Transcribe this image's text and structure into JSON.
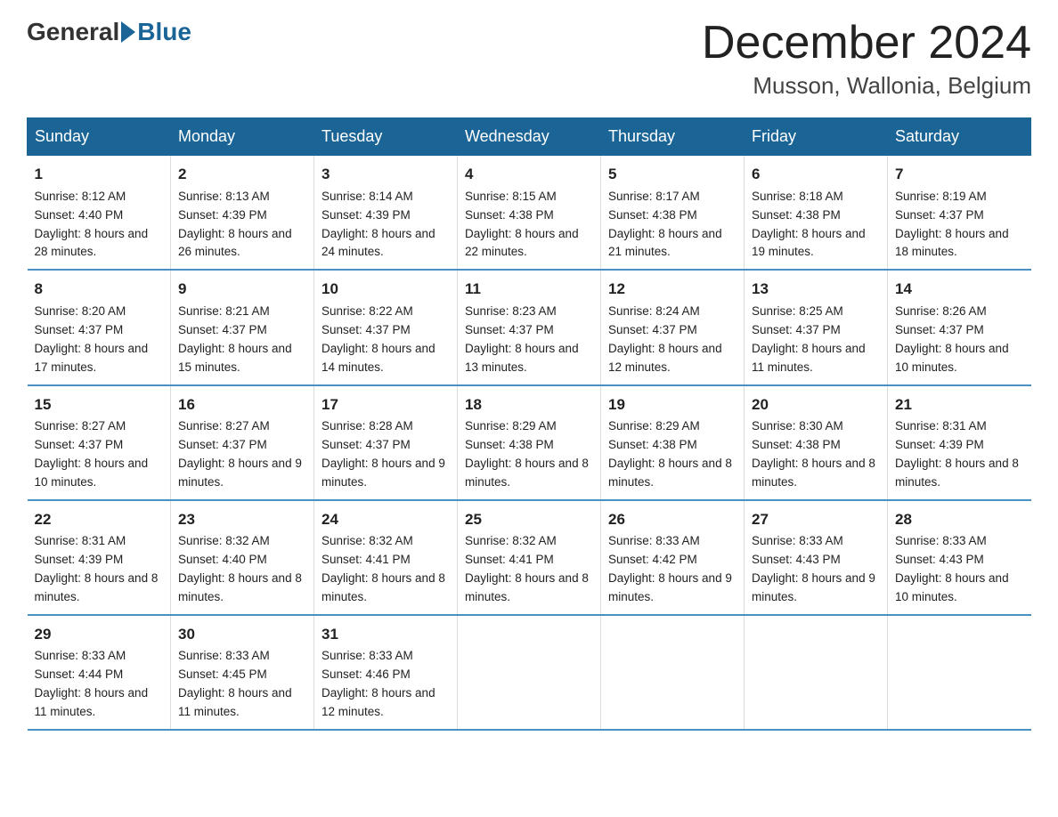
{
  "header": {
    "logo_general": "General",
    "logo_blue": "Blue",
    "month_title": "December 2024",
    "location": "Musson, Wallonia, Belgium"
  },
  "days_of_week": [
    "Sunday",
    "Monday",
    "Tuesday",
    "Wednesday",
    "Thursday",
    "Friday",
    "Saturday"
  ],
  "weeks": [
    [
      {
        "day": "1",
        "sunrise": "Sunrise: 8:12 AM",
        "sunset": "Sunset: 4:40 PM",
        "daylight": "Daylight: 8 hours and 28 minutes."
      },
      {
        "day": "2",
        "sunrise": "Sunrise: 8:13 AM",
        "sunset": "Sunset: 4:39 PM",
        "daylight": "Daylight: 8 hours and 26 minutes."
      },
      {
        "day": "3",
        "sunrise": "Sunrise: 8:14 AM",
        "sunset": "Sunset: 4:39 PM",
        "daylight": "Daylight: 8 hours and 24 minutes."
      },
      {
        "day": "4",
        "sunrise": "Sunrise: 8:15 AM",
        "sunset": "Sunset: 4:38 PM",
        "daylight": "Daylight: 8 hours and 22 minutes."
      },
      {
        "day": "5",
        "sunrise": "Sunrise: 8:17 AM",
        "sunset": "Sunset: 4:38 PM",
        "daylight": "Daylight: 8 hours and 21 minutes."
      },
      {
        "day": "6",
        "sunrise": "Sunrise: 8:18 AM",
        "sunset": "Sunset: 4:38 PM",
        "daylight": "Daylight: 8 hours and 19 minutes."
      },
      {
        "day": "7",
        "sunrise": "Sunrise: 8:19 AM",
        "sunset": "Sunset: 4:37 PM",
        "daylight": "Daylight: 8 hours and 18 minutes."
      }
    ],
    [
      {
        "day": "8",
        "sunrise": "Sunrise: 8:20 AM",
        "sunset": "Sunset: 4:37 PM",
        "daylight": "Daylight: 8 hours and 17 minutes."
      },
      {
        "day": "9",
        "sunrise": "Sunrise: 8:21 AM",
        "sunset": "Sunset: 4:37 PM",
        "daylight": "Daylight: 8 hours and 15 minutes."
      },
      {
        "day": "10",
        "sunrise": "Sunrise: 8:22 AM",
        "sunset": "Sunset: 4:37 PM",
        "daylight": "Daylight: 8 hours and 14 minutes."
      },
      {
        "day": "11",
        "sunrise": "Sunrise: 8:23 AM",
        "sunset": "Sunset: 4:37 PM",
        "daylight": "Daylight: 8 hours and 13 minutes."
      },
      {
        "day": "12",
        "sunrise": "Sunrise: 8:24 AM",
        "sunset": "Sunset: 4:37 PM",
        "daylight": "Daylight: 8 hours and 12 minutes."
      },
      {
        "day": "13",
        "sunrise": "Sunrise: 8:25 AM",
        "sunset": "Sunset: 4:37 PM",
        "daylight": "Daylight: 8 hours and 11 minutes."
      },
      {
        "day": "14",
        "sunrise": "Sunrise: 8:26 AM",
        "sunset": "Sunset: 4:37 PM",
        "daylight": "Daylight: 8 hours and 10 minutes."
      }
    ],
    [
      {
        "day": "15",
        "sunrise": "Sunrise: 8:27 AM",
        "sunset": "Sunset: 4:37 PM",
        "daylight": "Daylight: 8 hours and 10 minutes."
      },
      {
        "day": "16",
        "sunrise": "Sunrise: 8:27 AM",
        "sunset": "Sunset: 4:37 PM",
        "daylight": "Daylight: 8 hours and 9 minutes."
      },
      {
        "day": "17",
        "sunrise": "Sunrise: 8:28 AM",
        "sunset": "Sunset: 4:37 PM",
        "daylight": "Daylight: 8 hours and 9 minutes."
      },
      {
        "day": "18",
        "sunrise": "Sunrise: 8:29 AM",
        "sunset": "Sunset: 4:38 PM",
        "daylight": "Daylight: 8 hours and 8 minutes."
      },
      {
        "day": "19",
        "sunrise": "Sunrise: 8:29 AM",
        "sunset": "Sunset: 4:38 PM",
        "daylight": "Daylight: 8 hours and 8 minutes."
      },
      {
        "day": "20",
        "sunrise": "Sunrise: 8:30 AM",
        "sunset": "Sunset: 4:38 PM",
        "daylight": "Daylight: 8 hours and 8 minutes."
      },
      {
        "day": "21",
        "sunrise": "Sunrise: 8:31 AM",
        "sunset": "Sunset: 4:39 PM",
        "daylight": "Daylight: 8 hours and 8 minutes."
      }
    ],
    [
      {
        "day": "22",
        "sunrise": "Sunrise: 8:31 AM",
        "sunset": "Sunset: 4:39 PM",
        "daylight": "Daylight: 8 hours and 8 minutes."
      },
      {
        "day": "23",
        "sunrise": "Sunrise: 8:32 AM",
        "sunset": "Sunset: 4:40 PM",
        "daylight": "Daylight: 8 hours and 8 minutes."
      },
      {
        "day": "24",
        "sunrise": "Sunrise: 8:32 AM",
        "sunset": "Sunset: 4:41 PM",
        "daylight": "Daylight: 8 hours and 8 minutes."
      },
      {
        "day": "25",
        "sunrise": "Sunrise: 8:32 AM",
        "sunset": "Sunset: 4:41 PM",
        "daylight": "Daylight: 8 hours and 8 minutes."
      },
      {
        "day": "26",
        "sunrise": "Sunrise: 8:33 AM",
        "sunset": "Sunset: 4:42 PM",
        "daylight": "Daylight: 8 hours and 9 minutes."
      },
      {
        "day": "27",
        "sunrise": "Sunrise: 8:33 AM",
        "sunset": "Sunset: 4:43 PM",
        "daylight": "Daylight: 8 hours and 9 minutes."
      },
      {
        "day": "28",
        "sunrise": "Sunrise: 8:33 AM",
        "sunset": "Sunset: 4:43 PM",
        "daylight": "Daylight: 8 hours and 10 minutes."
      }
    ],
    [
      {
        "day": "29",
        "sunrise": "Sunrise: 8:33 AM",
        "sunset": "Sunset: 4:44 PM",
        "daylight": "Daylight: 8 hours and 11 minutes."
      },
      {
        "day": "30",
        "sunrise": "Sunrise: 8:33 AM",
        "sunset": "Sunset: 4:45 PM",
        "daylight": "Daylight: 8 hours and 11 minutes."
      },
      {
        "day": "31",
        "sunrise": "Sunrise: 8:33 AM",
        "sunset": "Sunset: 4:46 PM",
        "daylight": "Daylight: 8 hours and 12 minutes."
      },
      {
        "day": "",
        "sunrise": "",
        "sunset": "",
        "daylight": ""
      },
      {
        "day": "",
        "sunrise": "",
        "sunset": "",
        "daylight": ""
      },
      {
        "day": "",
        "sunrise": "",
        "sunset": "",
        "daylight": ""
      },
      {
        "day": "",
        "sunrise": "",
        "sunset": "",
        "daylight": ""
      }
    ]
  ]
}
